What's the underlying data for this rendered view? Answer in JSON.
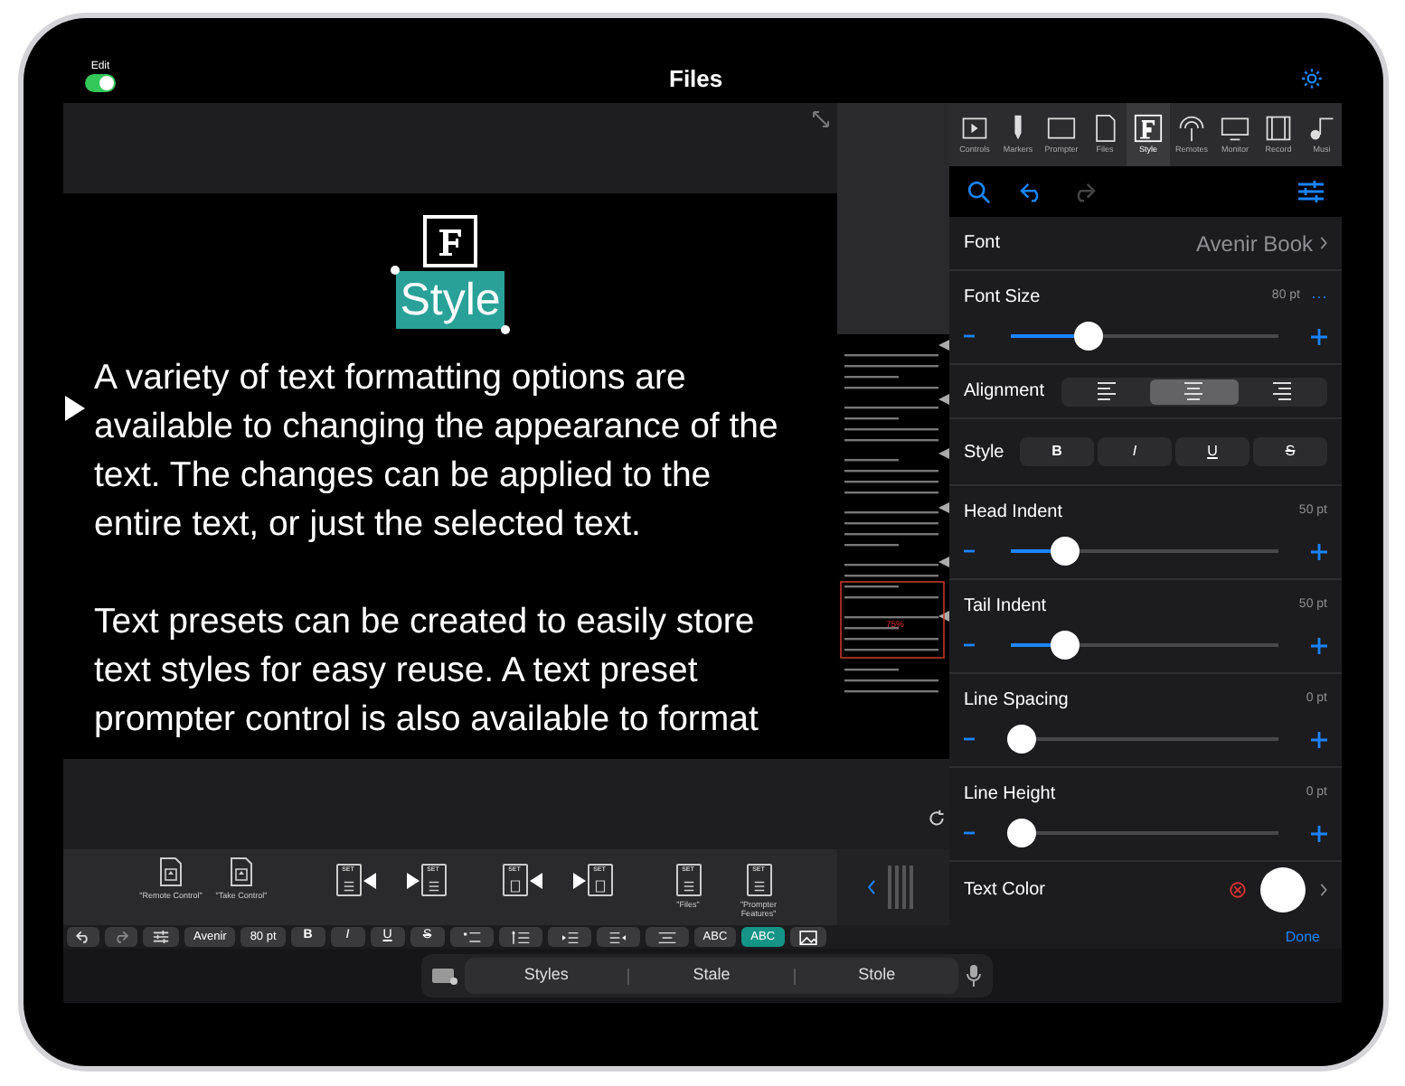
{
  "top_bar": {
    "edit_label": "Edit",
    "edit_on": true,
    "title": "Files"
  },
  "prompter": {
    "heading": "Style",
    "heading_selected": true,
    "paragraphs": [
      "A variety of text formatting options are available to changing the appearance of the text. The changes can be applied to the entire text, or just the selected text.",
      "Text presets can be created to easily store text styles for easy reuse. A text preset prompter control is also available to format"
    ]
  },
  "minimap": {
    "marker": "75%"
  },
  "tabs": [
    {
      "label": "Controls",
      "selected": false
    },
    {
      "label": "Markers",
      "selected": false
    },
    {
      "label": "Prompter",
      "selected": false
    },
    {
      "label": "Files",
      "selected": false
    },
    {
      "label": "Style",
      "selected": true
    },
    {
      "label": "Remotes",
      "selected": false
    },
    {
      "label": "Monitor",
      "selected": false
    },
    {
      "label": "Record",
      "selected": false
    },
    {
      "label": "Musi",
      "selected": false
    }
  ],
  "settings": [
    {
      "kind": "value",
      "label": "Font",
      "value": "Avenir  Book"
    },
    {
      "kind": "slider",
      "label": "Font Size",
      "reading": "80 pt",
      "level": 0.29,
      "more": "···"
    },
    {
      "kind": "segments",
      "label": "Alignment",
      "segments": [
        {
          "selected": false
        },
        {
          "selected": true
        },
        {
          "selected": false
        }
      ]
    },
    {
      "kind": "buttons",
      "label": "Style",
      "buttons": [
        "B",
        "I",
        "U",
        "S"
      ]
    },
    {
      "kind": "slider",
      "label": "Head Indent",
      "reading": "50 pt",
      "level": 0.2
    },
    {
      "kind": "slider",
      "label": "Tail Indent",
      "reading": "50 pt",
      "level": 0.2
    },
    {
      "kind": "slider",
      "label": "Line Spacing",
      "reading": "0 pt",
      "level": 0.04
    },
    {
      "kind": "slider",
      "label": "Line Height",
      "reading": "0 pt",
      "level": 0.04
    },
    {
      "kind": "color",
      "label": "Text Color",
      "color": "#ffffff"
    }
  ],
  "shortcuts": [
    {
      "kind": "remote",
      "label": "\"Remote Control\""
    },
    {
      "kind": "remote",
      "label": "\"Take Control\""
    },
    {
      "kind": "prev",
      "badge": "SET"
    },
    {
      "kind": "next",
      "badge": "SET"
    },
    {
      "kind": "prev-file",
      "badge": "SET"
    },
    {
      "kind": "next-file",
      "badge": "SET"
    },
    {
      "kind": "doc",
      "badge": "SET",
      "label": "\"Files\""
    },
    {
      "kind": "doc",
      "badge": "SET",
      "label": "\"Prompter Features\""
    }
  ],
  "format_bar": {
    "font": "Avenir",
    "size": "80 pt",
    "styles": [
      "B",
      "I",
      "U",
      "S"
    ],
    "abc": [
      {
        "label": "ABC",
        "selected": false
      },
      {
        "label": "ABC",
        "selected": true
      }
    ],
    "done": "Done"
  },
  "keyboard": {
    "suggestions": [
      "Styles",
      "Stale",
      "Stole"
    ]
  }
}
